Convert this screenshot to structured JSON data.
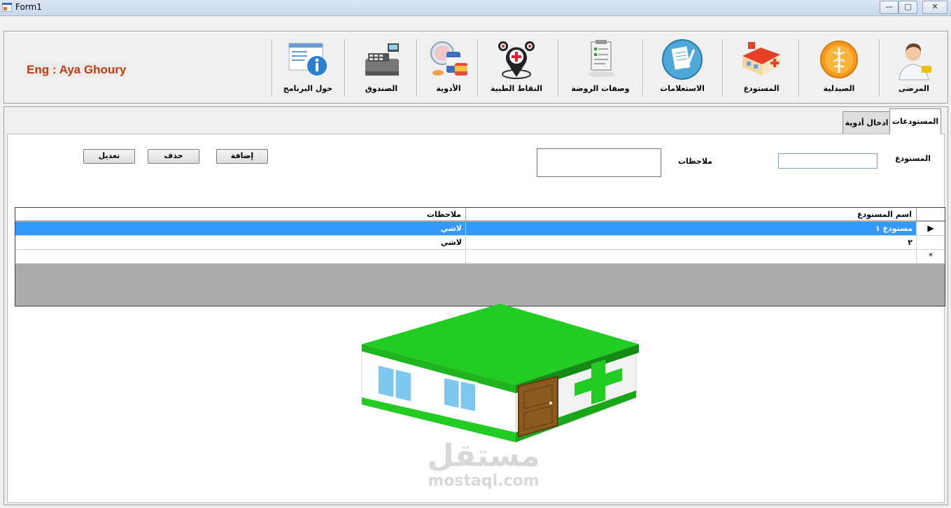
{
  "window": {
    "title": "Form1",
    "minimize": "—",
    "maximize": "▢",
    "close": "✕"
  },
  "brand": "Eng : Aya Ghoury",
  "toolbar": {
    "items": [
      {
        "id": "patients",
        "label": "المرضى",
        "icon": "doctor-icon"
      },
      {
        "id": "pharmacy",
        "label": "الصيدلية",
        "icon": "caduceus-icon"
      },
      {
        "id": "warehouse",
        "label": "المستودع",
        "icon": "warehouse-icon"
      },
      {
        "id": "queries",
        "label": "الاستعلامات",
        "icon": "queries-icon"
      },
      {
        "id": "prescriptions",
        "label": "وصفات الروضة",
        "icon": "prescription-icon"
      },
      {
        "id": "medical_points",
        "label": "النقاط الطبية",
        "icon": "map-pin-icon"
      },
      {
        "id": "medicines",
        "label": "الأدوية",
        "icon": "medicine-icon"
      },
      {
        "id": "cashbox",
        "label": "الصندوق",
        "icon": "cash-register-icon"
      },
      {
        "id": "about",
        "label": "حول البرنامج",
        "icon": "info-icon"
      }
    ]
  },
  "tabs": {
    "active": "المستودعات",
    "other": "ادخال أدوية"
  },
  "form": {
    "warehouse_label": "المستودع",
    "warehouse_value": "",
    "notes_label": "ملاحظات",
    "notes_value": "",
    "add_label": "إضافة",
    "delete_label": "حذف",
    "edit_label": "تعديل"
  },
  "grid": {
    "columns": [
      "اسم المستودع",
      "ملاحظات"
    ],
    "rows": [
      {
        "name": "مستودع ١",
        "notes": "لاشي",
        "selected": true
      },
      {
        "name": "٢",
        "notes": "لاشي",
        "selected": false
      }
    ],
    "new_row_marker": "*",
    "current_row_marker": "▶"
  },
  "watermark": {
    "arabic": "مستقل",
    "latin": "mostaql.com"
  },
  "colors": {
    "brand": "#c23b0c",
    "selection": "#3399ff",
    "roof": "#22cc22"
  }
}
